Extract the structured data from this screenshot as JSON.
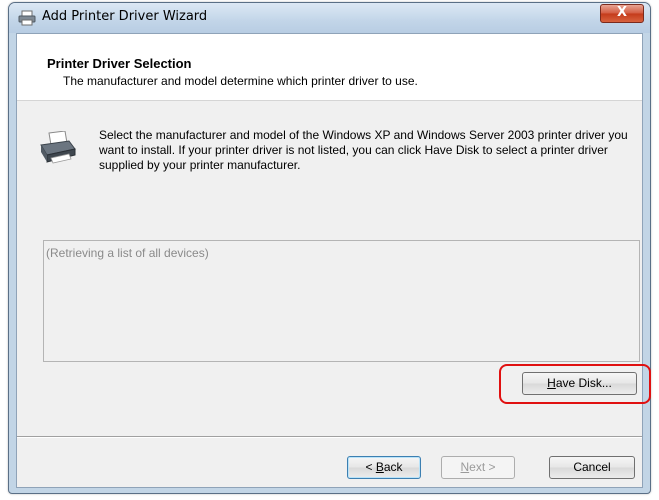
{
  "window": {
    "title": "Add Printer Driver Wizard",
    "close_label": "X"
  },
  "header": {
    "title": "Printer Driver Selection",
    "subtitle": "The manufacturer and model determine which printer driver to use."
  },
  "description": "Select the manufacturer and model of the Windows XP and Windows Server 2003 printer driver you want to install.  If your printer driver is not listed, you can click Have Disk to select a printer driver supplied by your printer manufacturer.",
  "device_list": {
    "status": "(Retrieving a list of all devices)"
  },
  "buttons": {
    "have_disk": {
      "mnemonic": "H",
      "rest": "ave Disk..."
    },
    "back": {
      "prefix": "< ",
      "mnemonic": "B",
      "rest": "ack"
    },
    "next": {
      "mnemonic": "N",
      "rest": "ext >"
    },
    "cancel": "Cancel"
  },
  "colors": {
    "highlight": "#e01010",
    "close_button": "#c43a1a",
    "window_frame": "#c2d5e6"
  },
  "icons": [
    "printer-icon",
    "printer-title-icon",
    "close-icon"
  ]
}
